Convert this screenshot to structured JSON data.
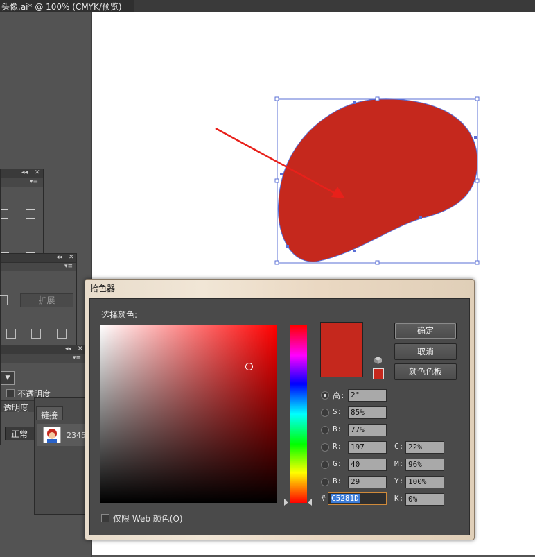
{
  "document_tab": {
    "title": "头像.ai* @ 100% (CMYK/预览)"
  },
  "panels": {
    "appearance": {
      "expand_label": "扩展"
    },
    "transparency": {
      "opacity_label": "不透明度",
      "tab_label": "透明度",
      "blend_mode": "正常"
    },
    "links": {
      "tab_label": "链接",
      "item_name": "2345"
    }
  },
  "color_picker": {
    "title": "拾色器",
    "select_label": "选择颜色:",
    "ok": "确定",
    "cancel": "取消",
    "swatches": "颜色色板",
    "hsb": {
      "h_label": "高:",
      "h_value": "2°",
      "s_label": "S:",
      "s_value": "85%",
      "b_label": "B:",
      "b_value": "77%"
    },
    "rgb": {
      "r_label": "R:",
      "r_value": "197",
      "g_label": "G:",
      "g_value": "40",
      "b_label": "B:",
      "b_value": "29"
    },
    "cmyk": {
      "c_label": "C:",
      "c_value": "22%",
      "m_label": "M:",
      "m_value": "96%",
      "y_label": "Y:",
      "y_value": "100%",
      "k_label": "K:",
      "k_value": "0%"
    },
    "hex_label": "#",
    "hex_value": "C5281D",
    "web_only_label": "仅限 Web 颜色(O)",
    "current_color": "#c5281d"
  },
  "icons": [
    "cube-icon",
    "arrow-annotation-icon"
  ],
  "colors": {
    "fill": "#c5281d",
    "selection": "#4a6fd8",
    "arrow": "#e8201a",
    "ui_dark": "#535353"
  }
}
